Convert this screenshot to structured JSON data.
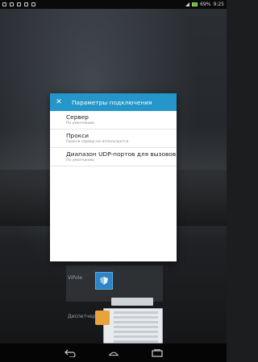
{
  "status_bar": {
    "battery_percent": "69%",
    "time": "9:25",
    "battery_color": "#5fb340"
  },
  "dialog": {
    "title": "Параметры подключения",
    "header_color": "#2596c9",
    "close_icon": "close-icon",
    "items": [
      {
        "title": "Сервер",
        "subtitle": "По умолчанию"
      },
      {
        "title": "Прокси",
        "subtitle": "Прокси сервер не используется"
      },
      {
        "title": "Диапазон UDP-портов для вызовов",
        "subtitle": "По умолчанию"
      }
    ]
  },
  "recents": {
    "app1_label": "ViPole",
    "app2_label": "Диспетчер"
  },
  "nav_bar": {
    "back_icon": "back-icon",
    "home_icon": "home-icon",
    "recents_icon": "recents-icon"
  }
}
